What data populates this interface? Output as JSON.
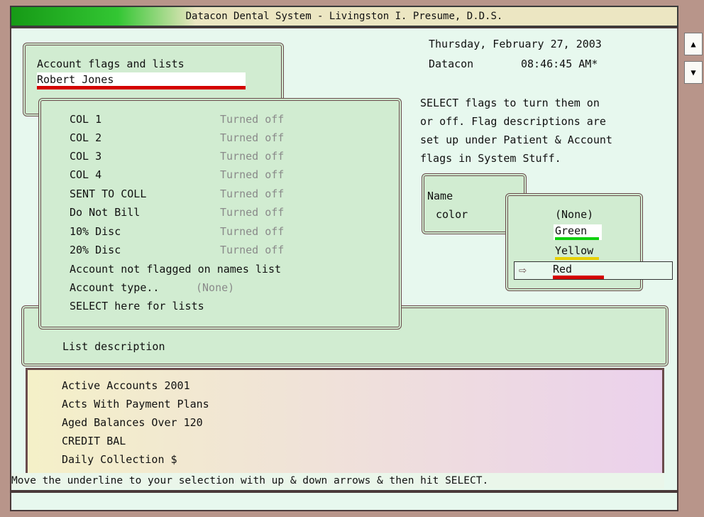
{
  "title": "Datacon Dental System  - Livingston I. Presume, D.D.S.",
  "datetime": {
    "date": "Thursday, February 27, 2003",
    "user": "Datacon",
    "time": "08:46:45 AM*"
  },
  "header": {
    "title": "Account flags and lists",
    "patient": "Robert Jones"
  },
  "help": [
    "SELECT flags to turn them on",
    "or off. Flag descriptions are",
    "set up under Patient & Account",
    "flags in System Stuff."
  ],
  "flags": [
    {
      "name": "COL 1",
      "status": "Turned off"
    },
    {
      "name": "COL 2",
      "status": "Turned off"
    },
    {
      "name": "COL 3",
      "status": "Turned off"
    },
    {
      "name": "COL 4",
      "status": "Turned off"
    },
    {
      "name": "SENT TO COLL",
      "status": "Turned off"
    },
    {
      "name": "Do Not Bill",
      "status": "Turned off"
    },
    {
      "name": "10% Disc",
      "status": "Turned off"
    },
    {
      "name": "20% Disc",
      "status": "Turned off"
    }
  ],
  "flag_extra": {
    "not_flagged": "Account not flagged on names list",
    "account_type_label": "Account type..",
    "account_type_value": "(None)",
    "select_lists": "SELECT here for lists"
  },
  "name_color": {
    "line1": "Name",
    "line2": "color"
  },
  "colors": {
    "options": [
      "(None)",
      "Green",
      "Yellow",
      "Red"
    ],
    "selected": "Red",
    "pointer": "⇨"
  },
  "list_description": "List description",
  "lists": [
    "Active Accounts 2001",
    "Acts With Payment Plans",
    "Aged Balances Over 120",
    "CREDIT BAL",
    "Daily Collection $"
  ],
  "message": "Move the underline to your selection with up & down arrows & then hit SELECT.",
  "scroll": {
    "up": "▲",
    "down": "▼"
  },
  "theme": {
    "title_green": "#169a16",
    "panel_bg": "#e7f8ee",
    "box_bg": "#d1ecd1",
    "frame": "#b8958a",
    "red": "#d40000",
    "green": "#10d010",
    "yellow": "#e8d000"
  }
}
